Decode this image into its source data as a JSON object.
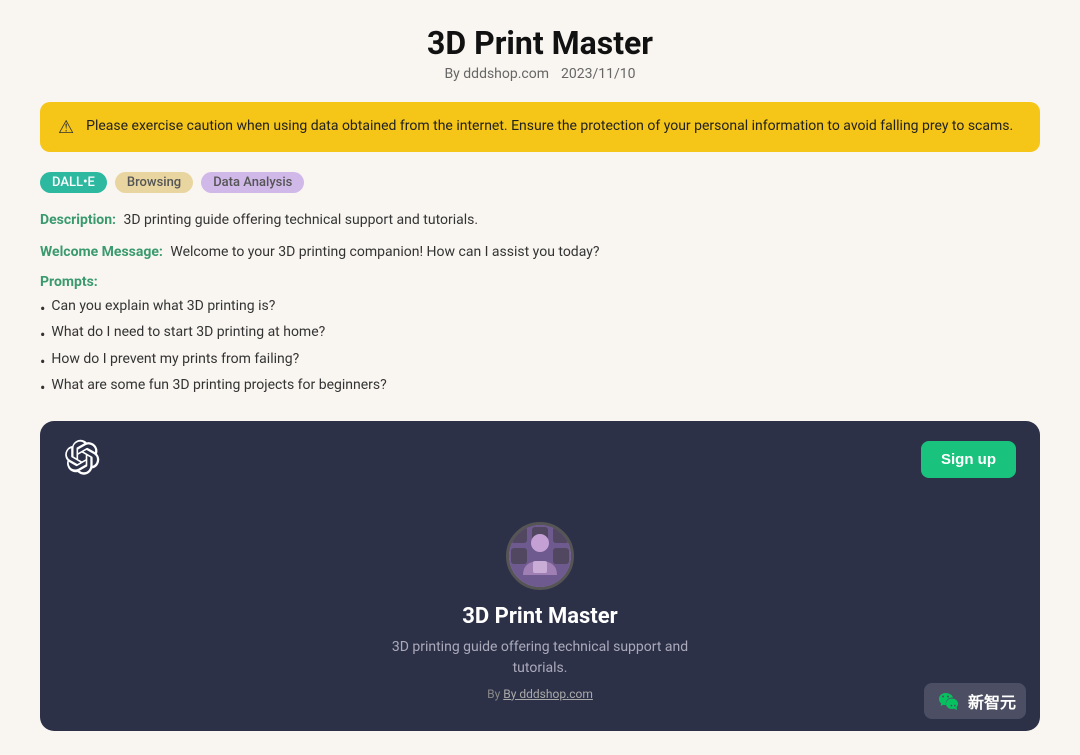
{
  "header": {
    "title": "3D Print Master",
    "by_label": "By dddshop.com",
    "date": "2023/11/10"
  },
  "warning": {
    "text": "Please exercise caution when using data obtained from the internet. Ensure the protection of your personal information to avoid falling prey to scams."
  },
  "tags": [
    {
      "label": "DALL•E",
      "class": "tag-dalle"
    },
    {
      "label": "Browsing",
      "class": "tag-browsing"
    },
    {
      "label": "Data Analysis",
      "class": "tag-data-analysis"
    }
  ],
  "description": {
    "label": "Description:",
    "value": "3D printing guide offering technical support and tutorials."
  },
  "welcome": {
    "label": "Welcome Message:",
    "value": "Welcome to your 3D printing companion! How can I assist you today?"
  },
  "prompts": {
    "label": "Prompts:",
    "items": [
      "Can you explain what 3D printing is?",
      "What do I need to start 3D printing at home?",
      "How do I prevent my prints from failing?",
      "What are some fun 3D printing projects for beginners?"
    ]
  },
  "dark_panel": {
    "signup_label": "Sign up",
    "title": "3D Print Master",
    "description": "3D printing guide offering technical support and tutorials.",
    "byline": "By dddshop.com"
  },
  "watermark": {
    "label": "新智元"
  }
}
